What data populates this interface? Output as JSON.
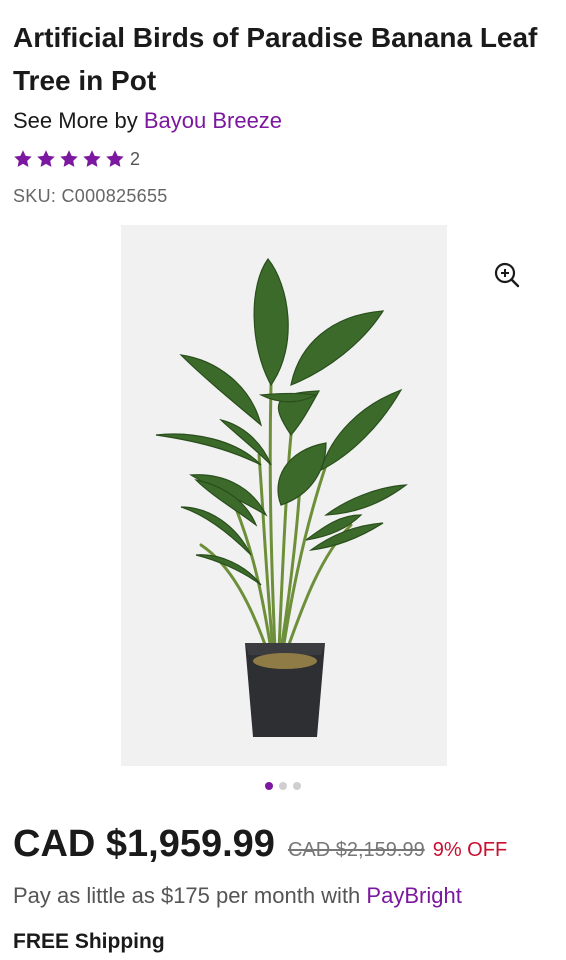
{
  "product": {
    "title": "Artificial Birds of Paradise Banana Leaf Tree in Pot",
    "see_more_prefix": "See More by ",
    "brand": "Bayou Breeze",
    "rating": {
      "stars": 5,
      "count": "2"
    },
    "sku": "SKU: C000825655",
    "image": {
      "alt": "Artificial Birds of Paradise plant in a black square pot",
      "slide_count": 3,
      "active_slide": 1
    }
  },
  "pricing": {
    "price": "CAD $1,959.99",
    "original_price": "CAD $2,159.99",
    "discount": "9% OFF"
  },
  "financing": {
    "text_prefix": "Pay as little as $175 per month with ",
    "provider": "PayBright"
  },
  "shipping": {
    "label": "FREE Shipping"
  },
  "colors": {
    "accent": "#7b189f",
    "discount": "#c8102e"
  },
  "icons": {
    "zoom": "zoom-in-icon",
    "star": "star-icon"
  }
}
